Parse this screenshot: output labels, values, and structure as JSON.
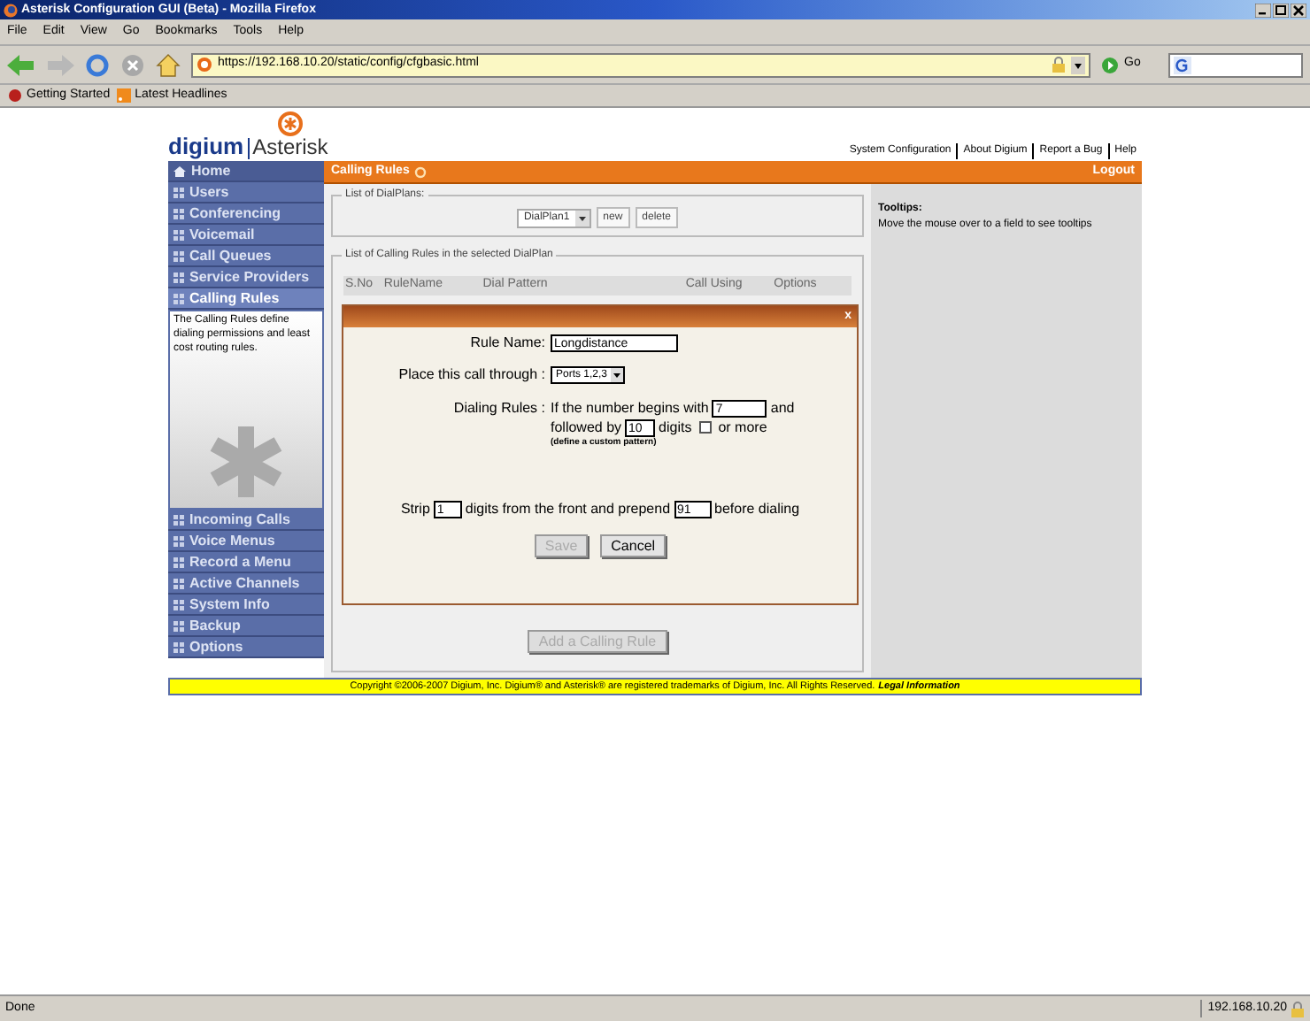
{
  "window": {
    "title": "Asterisk Configuration GUI (Beta) - Mozilla Firefox"
  },
  "menu": [
    "File",
    "Edit",
    "View",
    "Go",
    "Bookmarks",
    "Tools",
    "Help"
  ],
  "navigation": {
    "url": "https://192.168.10.20/static/config/cfgbasic.html",
    "go": "Go"
  },
  "bookmarks": [
    "Getting Started",
    "Latest Headlines"
  ],
  "app": {
    "logo": {
      "left": "digium",
      "right": "Asterisk"
    },
    "top_links": [
      "System Configuration",
      "About Digium",
      "Report a Bug",
      "Help"
    ],
    "header": {
      "title": "Calling Rules",
      "logout": "Logout"
    },
    "sidebar": {
      "items": [
        {
          "label": "Home",
          "kind": "home",
          "selected": false
        },
        {
          "label": "Users",
          "kind": "section",
          "selected": false
        },
        {
          "label": "Conferencing",
          "kind": "section",
          "selected": false
        },
        {
          "label": "Voicemail",
          "kind": "section",
          "selected": false
        },
        {
          "label": "Call Queues",
          "kind": "section",
          "selected": false
        },
        {
          "label": "Service Providers",
          "kind": "section",
          "selected": false
        },
        {
          "label": "Calling Rules",
          "kind": "section",
          "selected": true
        },
        {
          "label": "Incoming Calls",
          "kind": "section",
          "selected": false
        },
        {
          "label": "Voice Menus",
          "kind": "section",
          "selected": false
        },
        {
          "label": "Record a Menu",
          "kind": "section",
          "selected": false
        },
        {
          "label": "Active Channels",
          "kind": "section",
          "selected": false
        },
        {
          "label": "System Info",
          "kind": "section",
          "selected": false
        },
        {
          "label": "Backup",
          "kind": "section",
          "selected": false
        },
        {
          "label": "Options",
          "kind": "section",
          "selected": false
        }
      ],
      "description": "The Calling Rules define dialing permissions and least cost routing rules."
    },
    "dialplans": {
      "legend": "List of DialPlans:",
      "value": "DialPlan1",
      "buttons": [
        "new",
        "delete"
      ]
    },
    "rules": {
      "legend": "List of Calling Rules in the selected DialPlan",
      "columns": [
        "S.No",
        "RuleName",
        "Dial Pattern",
        "Call Using",
        "Options"
      ],
      "add_button": {
        "label": "Add a Calling Rule",
        "disabled": true
      }
    },
    "dialog": {
      "close": "x",
      "rule_name": {
        "label": "Rule Name:",
        "value": "Longdistance"
      },
      "place": {
        "label": "Place this call through :",
        "value": "Ports 1,2,3"
      },
      "dialing": {
        "label": "Dialing Rules :",
        "begins_text": "If the number begins with",
        "begins_value": "7",
        "and_text": "and",
        "followed_text": "followed by",
        "digits_value": "10",
        "digits_text": "digits",
        "or_more_checked": false,
        "or_more_text": "or more",
        "hint": "(define a custom pattern)"
      },
      "strip": {
        "strip_text": "Strip",
        "strip_value": "1",
        "front_text": "digits from the front and prepend",
        "prepend_value": "91",
        "before_text": "before dialing"
      },
      "buttons": [
        {
          "label": "Save",
          "disabled": true
        },
        {
          "label": "Cancel",
          "disabled": false
        }
      ]
    },
    "tooltips": {
      "title": "Tooltips:",
      "text": "Move the mouse over to a field to see tooltips"
    },
    "footer": {
      "text": "Copyright ©2006-2007 Digium, Inc. Digium® and Asterisk® are registered trademarks of Digium, Inc. All Rights Reserved.",
      "link": "Legal Information"
    }
  },
  "status_bar": {
    "text": "Done",
    "host": "192.168.10.20"
  }
}
